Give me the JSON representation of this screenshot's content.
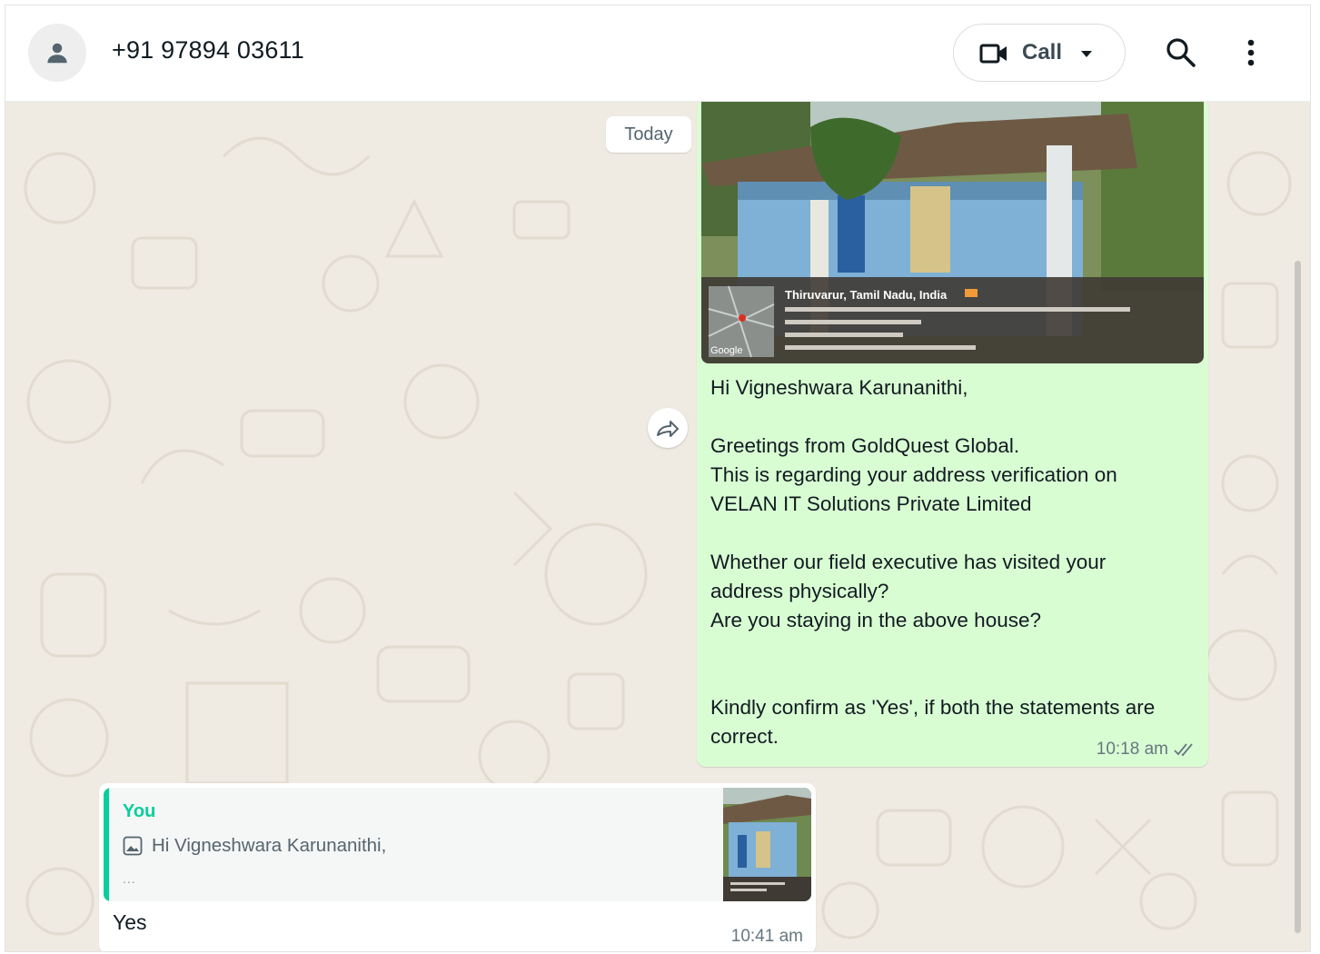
{
  "header": {
    "contact_name": "+91 97894 03611",
    "call_label": "Call",
    "icons": [
      "person-avatar-icon",
      "video-camera-icon",
      "caret-down-icon",
      "search-icon",
      "kebab-menu-icon"
    ]
  },
  "chat": {
    "date_divider": "Today",
    "outgoing_message": {
      "image_overlay": {
        "place": "Thiruvarur, Tamil Nadu, India",
        "map_label": "Google"
      },
      "paragraphs": [
        "Hi Vigneshwara Karunanithi,",
        "Greetings from GoldQuest Global.\nThis is regarding your address verification on\nVELAN IT Solutions Private Limited",
        "Whether our field executive has visited your\naddress physically?\nAre you staying in the above house?",
        "Kindly confirm as 'Yes', if both the statements are\ncorrect."
      ],
      "time": "10:18 am",
      "status": "read"
    },
    "reply_message": {
      "quote_author": "You",
      "quote_text": "Hi Vigneshwara Karunanithi,",
      "quote_more": "...",
      "text": "Yes",
      "time": "10:41 am"
    }
  },
  "colors": {
    "outgoing_bubble": "#d9fdd3",
    "incoming_bubble": "#ffffff",
    "chat_background": "#efeae2",
    "quote_accent": "#06cf9c"
  }
}
